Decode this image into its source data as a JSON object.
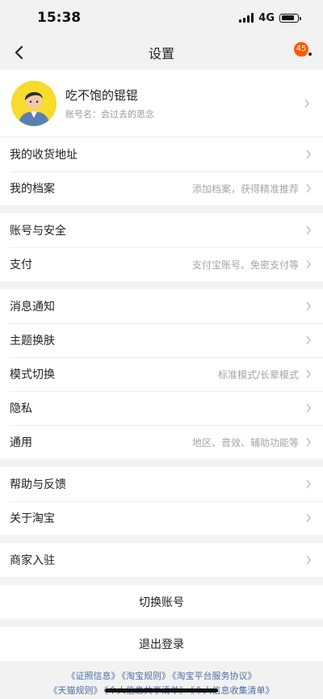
{
  "status": {
    "time": "15:38",
    "network": "4G"
  },
  "nav": {
    "title": "设置",
    "badge": "45"
  },
  "profile": {
    "nickname": "吃不饱的锟锟",
    "account": "账号名：会过去的思念"
  },
  "groups": [
    [
      {
        "label": "我的收货地址",
        "hint": ""
      },
      {
        "label": "我的档案",
        "hint": "添加档案，获得精准推荐"
      }
    ],
    [
      {
        "label": "账号与安全",
        "hint": ""
      },
      {
        "label": "支付",
        "hint": "支付宝账号、免密支付等"
      }
    ],
    [
      {
        "label": "消息通知",
        "hint": ""
      },
      {
        "label": "主题换肤",
        "hint": ""
      },
      {
        "label": "模式切换",
        "hint": "标准模式/长辈模式"
      },
      {
        "label": "隐私",
        "hint": ""
      },
      {
        "label": "通用",
        "hint": "地区、音效、辅助功能等"
      }
    ],
    [
      {
        "label": "帮助与反馈",
        "hint": ""
      },
      {
        "label": "关于淘宝",
        "hint": ""
      }
    ],
    [
      {
        "label": "商家入驻",
        "hint": ""
      }
    ]
  ],
  "actions": {
    "switch_account": "切换账号",
    "logout": "退出登录"
  },
  "footer": {
    "line1": [
      "《证照信息》",
      "《淘宝规则》",
      "《淘宝平台服务协议》"
    ],
    "line2": [
      "《天猫规则》",
      "《个人信息共享清单》",
      "《个人信息收集清单》"
    ]
  },
  "colors": {
    "accent": "#ff5a00",
    "link": "#4a6fa5",
    "avatar_bg": "#f7dc2e"
  },
  "icons": {
    "back": "chevron-left-icon",
    "more": "more-dots-icon",
    "row_arrow": "chevron-right-icon"
  }
}
